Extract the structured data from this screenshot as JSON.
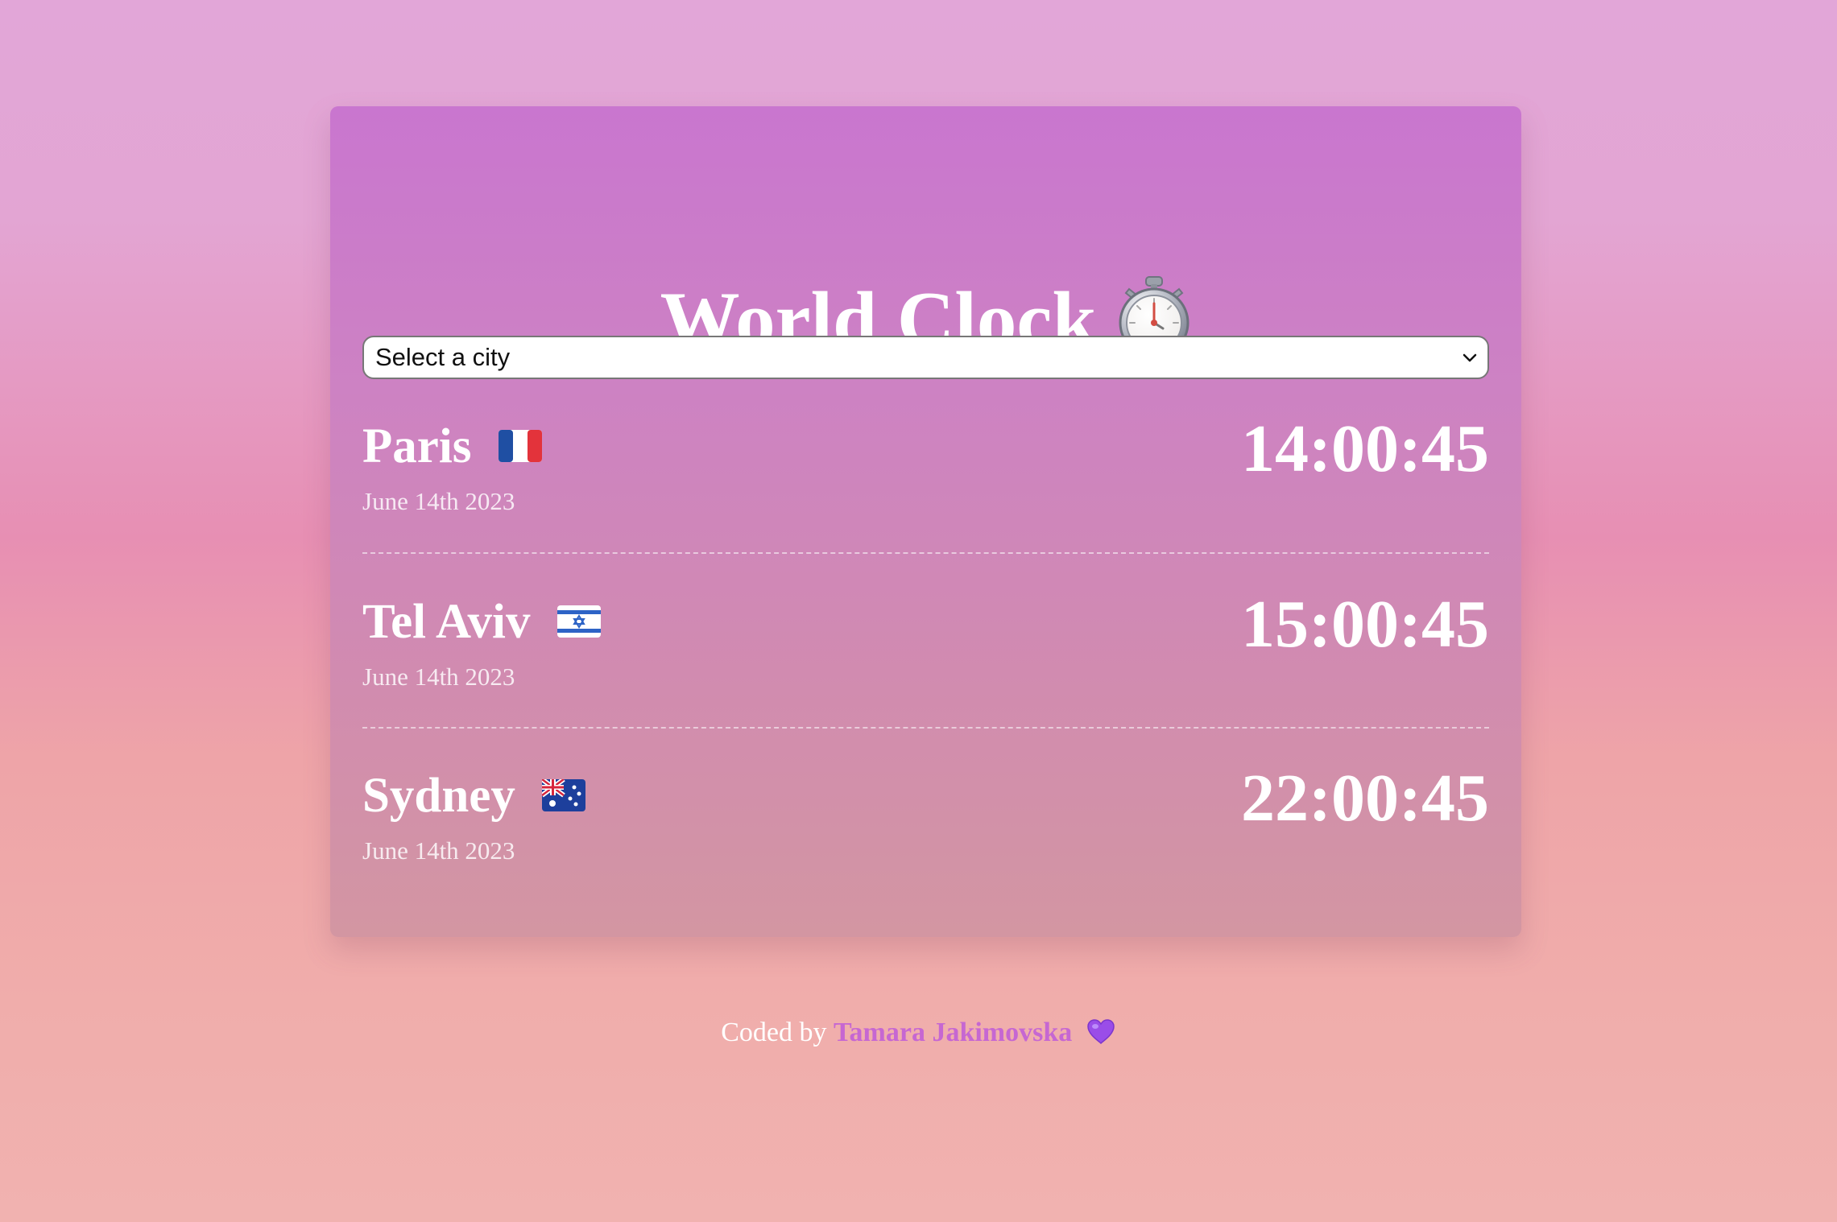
{
  "header": {
    "title": "World Clock",
    "title_icon": "stopwatch-icon"
  },
  "selector": {
    "placeholder": "Select a city",
    "icon": "chevron-down-icon"
  },
  "cities": [
    {
      "name": "Paris",
      "flag": "france-flag-icon",
      "date": "June 14th 2023",
      "time": "14:00:45"
    },
    {
      "name": "Tel Aviv",
      "flag": "israel-flag-icon",
      "date": "June 14th 2023",
      "time": "15:00:45"
    },
    {
      "name": "Sydney",
      "flag": "australia-flag-icon",
      "date": "June 14th 2023",
      "time": "22:00:45"
    }
  ],
  "footer": {
    "prefix": "Coded by",
    "author": "Tamara Jakimovska",
    "heart_icon": "purple-heart-icon"
  },
  "colors": {
    "accent": "#c667d2",
    "white": "#ffffff"
  }
}
